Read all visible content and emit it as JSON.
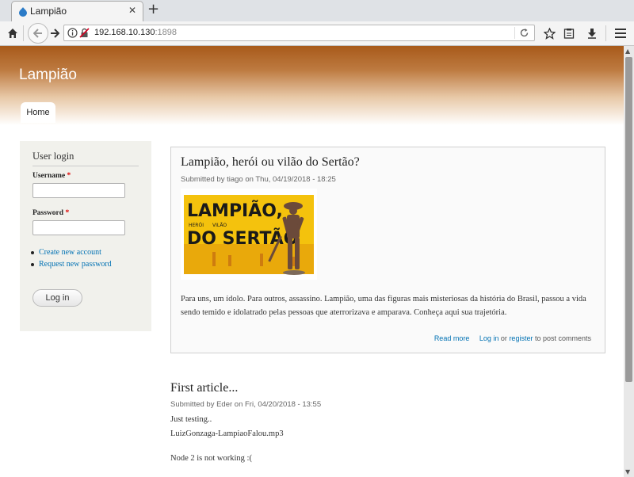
{
  "browser": {
    "tab_title": "Lampião",
    "tab_close": "✕",
    "new_tab": "+",
    "url_host": "192.168.10.130",
    "url_port": ":1898"
  },
  "page": {
    "site_name": "Lampião",
    "nav": {
      "home_label": "Home"
    }
  },
  "sidebar": {
    "block_title": "User login",
    "username_label": "Username",
    "password_label": "Password",
    "required_mark": "*",
    "links": [
      "Create new account",
      "Request new password"
    ],
    "login_button": "Log in"
  },
  "articles": [
    {
      "title": "Lampião, herói ou vilão do Sertão?",
      "meta": "Submitted by tiago on Thu, 04/19/2018 - 18:25",
      "image": {
        "line1": "LAMPIÃO,",
        "line2": "HERÓI",
        "line3": "VILÃO",
        "line4": "DO SERTÃO"
      },
      "body": "Para uns, um ídolo. Para outros, assassino. Lampião, uma das figuras mais misteriosas da história do Brasil, passou a vida sendo temido e idolatrado pelas pessoas que aterrorizava e amparava. Conheça aqui sua trajetória.",
      "read_more": "Read more",
      "log_in": "Log in",
      "or": "or",
      "register": "register",
      "post_comments": "to post comments"
    },
    {
      "title": "First article...",
      "meta": "Submitted by Eder on Fri, 04/20/2018 - 13:55",
      "line1": "Just testing..",
      "line2": "LuizGonzaga-LampiaoFalou.mp3",
      "line3": "Node 2 is not working :("
    }
  ],
  "colors": {
    "header_top": "#a85a1a",
    "link": "#0071b3",
    "sidebar_bg": "#f1f1ec"
  }
}
